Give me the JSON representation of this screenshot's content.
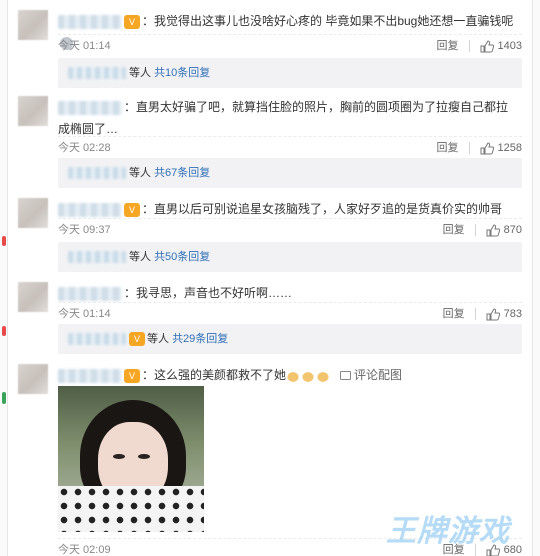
{
  "comments": [
    {
      "text": "：我觉得出这事儿也没啥好心疼的 毕竟如果不出bug她还想一直骗钱呢",
      "time": "今天 01:14",
      "reply_label": "回复",
      "likes": "1403",
      "sub_replies": {
        "prefix": "等人",
        "more": "共10条回复"
      }
    },
    {
      "text_line1": "：直男太好骗了吧，就算挡住脸的照片，胸前的圆项圈为了拉瘦自己都拉",
      "text_line2": "成椭圆了…",
      "time": "今天 02:28",
      "reply_label": "回复",
      "likes": "1258",
      "sub_replies": {
        "prefix": "等人",
        "more": "共67条回复"
      }
    },
    {
      "text": "：直男以后可别说追星女孩脑残了，人家好歹追的是货真价实的帅哥",
      "time": "今天 09:37",
      "reply_label": "回复",
      "likes": "870",
      "sub_replies": {
        "prefix": "等人",
        "more": "共50条回复"
      }
    },
    {
      "text": "：我寻思，声音也不好听啊……",
      "time": "今天 01:14",
      "reply_label": "回复",
      "likes": "783",
      "sub_replies": {
        "prefix": "等人",
        "more": "共29条回复"
      }
    },
    {
      "text": "：这么强的美颜都救不了她",
      "comment_images_label": "评论配图",
      "time": "今天 02:09",
      "reply_label": "回复",
      "likes": "680"
    }
  ],
  "watermark": "王牌游戏",
  "icons": {
    "like": "thumbs-up-icon",
    "badge": "member-badge-icon",
    "image": "picture-icon"
  },
  "colors": {
    "link": "#2f6fb6",
    "subbox": "#f2f2f5",
    "watermark": "#78bef0"
  }
}
